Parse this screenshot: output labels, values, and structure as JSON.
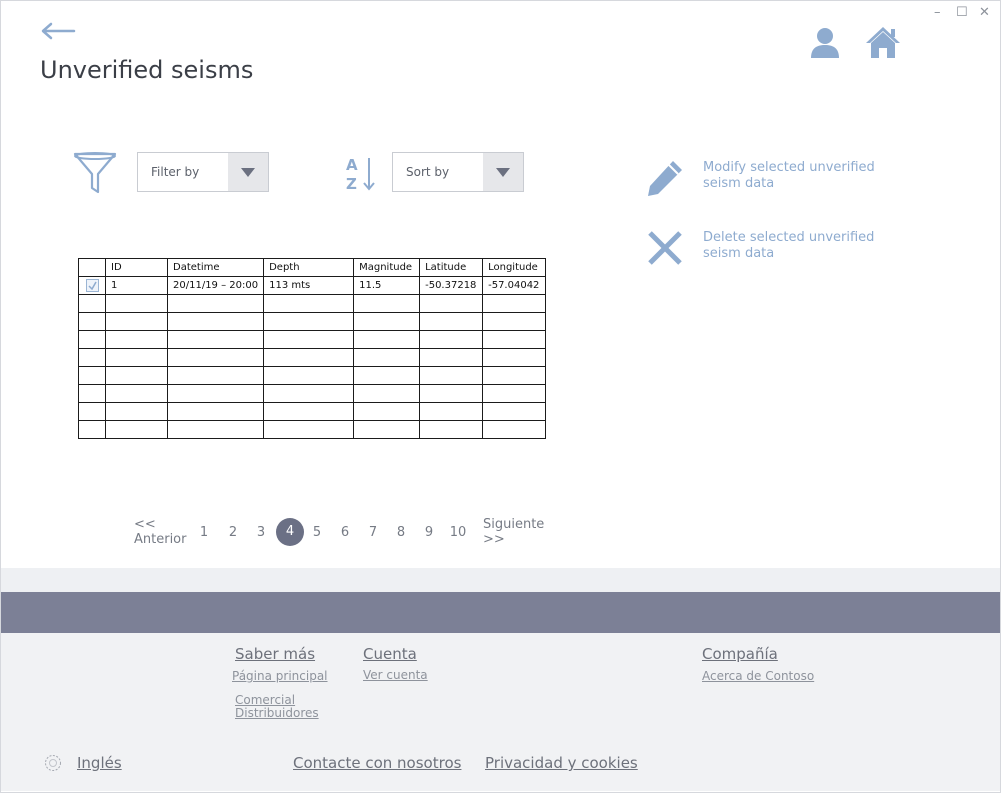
{
  "window": {
    "minimize": "–",
    "maximize": "☐",
    "close": "✕"
  },
  "page": {
    "title": "Unverified seisms"
  },
  "toolbar": {
    "filter_placeholder": "Filter by",
    "sort_placeholder": "Sort by"
  },
  "actions": {
    "modify_label": "Modify selected unverified seism data",
    "delete_label": "Delete selected unverified seism data"
  },
  "table": {
    "headers": [
      "ID",
      "Datetime",
      "Depth",
      "Magnitude",
      "Latitude",
      "Longitude"
    ],
    "rows": [
      {
        "checked": true,
        "id": "1",
        "datetime": "20/11/19 – 20:00",
        "depth": "113 mts",
        "magnitude": "11.5",
        "latitude": "-50.37218",
        "longitude": "-57.04042"
      }
    ],
    "empty_rows": 8
  },
  "pagination": {
    "prev": "<<\nAnterior",
    "next": "Siguiente\n>>",
    "pages": [
      "1",
      "2",
      "3",
      "4",
      "5",
      "6",
      "7",
      "8",
      "9",
      "10"
    ],
    "current": "4"
  },
  "footer": {
    "saber_mas": {
      "title": "Saber más",
      "links": [
        "Página principal",
        "Comercial Distribuidores"
      ]
    },
    "cuenta": {
      "title": "Cuenta",
      "links": [
        "Ver cuenta"
      ]
    },
    "compania": {
      "title": "Compañía",
      "links": [
        "Acerca de Contoso"
      ]
    },
    "language": "Inglés",
    "contact": "Contacte con nosotros",
    "privacy": "Privacidad y cookies"
  },
  "colors": {
    "accent": "#8eabcf",
    "pager_active": "#6b7085",
    "band": "#7c8096"
  }
}
